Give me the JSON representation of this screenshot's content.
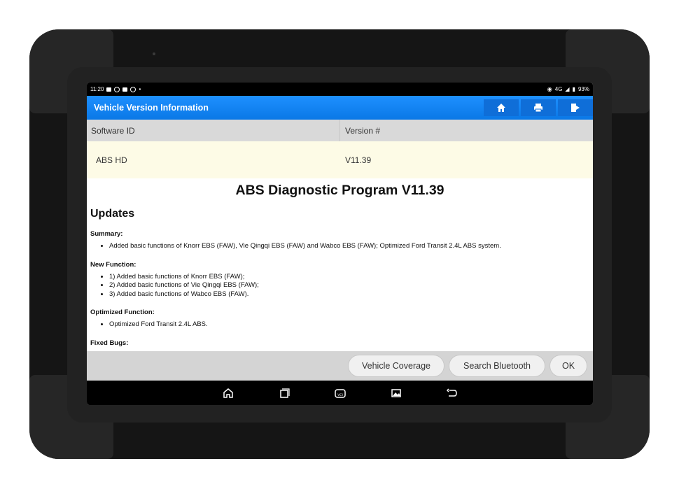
{
  "status_bar": {
    "time": "11:20",
    "battery": "93%",
    "network": "4G"
  },
  "app_bar": {
    "title": "Vehicle Version Information",
    "actions": [
      {
        "name": "home",
        "icon": "home-icon"
      },
      {
        "name": "print",
        "icon": "printer-icon"
      },
      {
        "name": "exit",
        "icon": "exit-icon"
      }
    ]
  },
  "table": {
    "headers": [
      "Software ID",
      "Version #"
    ],
    "rows": [
      [
        "ABS HD",
        "V11.39"
      ]
    ]
  },
  "document": {
    "title": "ABS Diagnostic Program V11.39",
    "section_heading": "Updates",
    "summary_label": "Summary:",
    "summary_items": [
      "Added basic functions of Knorr EBS (FAW), Vie Qingqi EBS (FAW) and Wabco EBS (FAW); Optimized Ford Transit 2.4L ABS system."
    ],
    "new_function_label": "New Function:",
    "new_function_items": [
      "1) Added basic functions of Knorr EBS (FAW);",
      "2) Added basic functions of Vie Qingqi EBS (FAW);",
      "3) Added basic functions of Wabco EBS (FAW)."
    ],
    "optimized_label": "Optimized Function:",
    "optimized_items": [
      "Optimized Ford Transit 2.4L ABS."
    ],
    "fixed_bugs_label": "Fixed Bugs:"
  },
  "buttons": {
    "vehicle_coverage": "Vehicle Coverage",
    "search_bluetooth": "Search Bluetooth",
    "ok": "OK"
  },
  "nav_bar": {
    "icons": [
      "home-icon",
      "recents-icon",
      "vci-icon",
      "screenshot-icon",
      "back-icon"
    ],
    "vci_label": "VCI"
  },
  "colors": {
    "app_bar": "#1e90ff",
    "row_highlight": "#fdfbe6",
    "header_bg": "#d9d9d9"
  }
}
